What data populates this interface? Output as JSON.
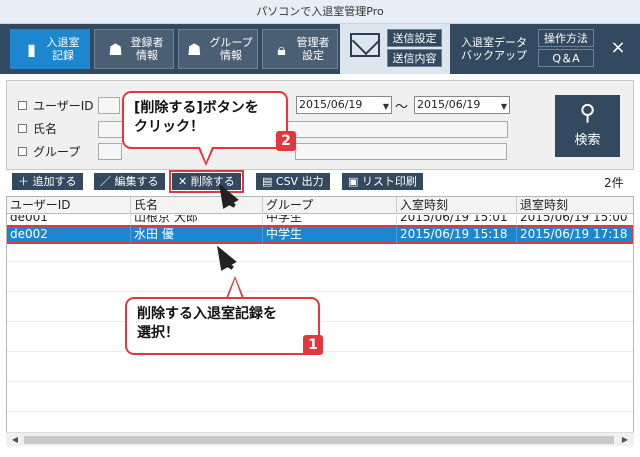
{
  "window": {
    "title": "パソコンで入退室管理Pro"
  },
  "toolbar": {
    "items": [
      {
        "label": "入退室\n記録",
        "icon": "door-icon"
      },
      {
        "label": "登録者\n情報",
        "icon": "user-icon"
      },
      {
        "label": "グループ\n情報",
        "icon": "group-icon"
      },
      {
        "label": "管理者\n設定",
        "icon": "lock-icon"
      }
    ],
    "mail": {
      "settings": "送信設定",
      "content": "送信内容"
    },
    "backup": "入退室データ\nバックアップ",
    "help": "操作方法",
    "qa": "Q＆A",
    "close": "×"
  },
  "filter": {
    "user_id_label": "ユーザーID",
    "name_label": "氏名",
    "group_label": "グループ",
    "date_from": "2015/06/19",
    "date_to": "2015/06/19",
    "tilde": "～",
    "search_label": "検索"
  },
  "actions": {
    "add": "＋ 追加する",
    "edit": "／ 編集する",
    "delete": "✕ 削除する",
    "csv": "CSV 出力",
    "print": "リスト印刷",
    "count": "2件"
  },
  "table": {
    "columns": [
      "ユーザーID",
      "氏名",
      "グループ",
      "入室時刻",
      "退室時刻"
    ],
    "rows": [
      [
        "de001",
        "山根京 大郎",
        "中学生",
        "2015/06/19 15:01",
        "2015/06/19 15:00"
      ],
      [
        "de002",
        "水田 優",
        "中学生",
        "2015/06/19 15:18",
        "2015/06/19 17:18"
      ]
    ]
  },
  "callouts": {
    "step2_text": "[削除する]ボタンを\nクリック！",
    "step2_num": "2",
    "step1_text": "削除する入退室記録を\n選択！",
    "step1_num": "1"
  }
}
